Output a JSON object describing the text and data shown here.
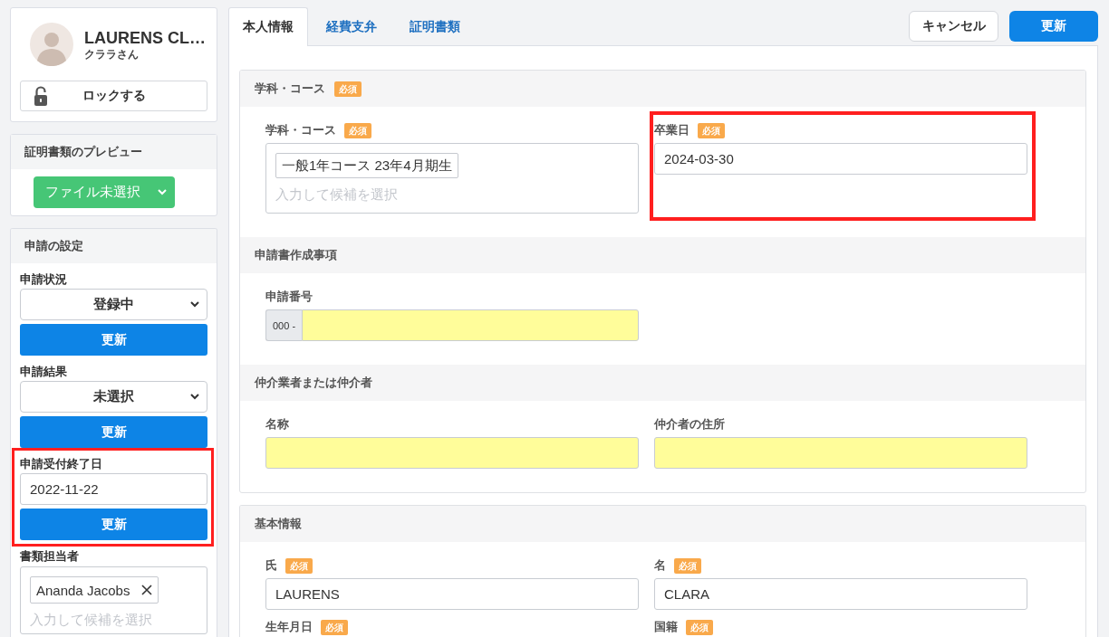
{
  "profile": {
    "name": "LAURENS CL…",
    "nickname": "クララさん",
    "lock_button": "ロックする"
  },
  "preview_panel": {
    "title": "証明書類のプレビュー",
    "file_select": "ファイル未選択"
  },
  "settings_panel": {
    "title": "申請の設定",
    "items": [
      {
        "kind": "select",
        "label": "申請状況",
        "value": "登録中",
        "button": "更新",
        "annotated": false
      },
      {
        "kind": "select",
        "label": "申請結果",
        "value": "未選択",
        "button": "更新",
        "annotated": false
      },
      {
        "kind": "date",
        "label": "申請受付終了日",
        "value": "2022-11-22",
        "button": "更新",
        "annotated": true
      },
      {
        "kind": "tags",
        "label": "書類担当者",
        "tags": [
          {
            "label": "Ananda Jacobs",
            "removable": true
          }
        ],
        "placeholder": "入力して候補を選択",
        "annotated": false
      }
    ]
  },
  "tabs": [
    {
      "label": "本人情報",
      "selected": true
    },
    {
      "label": "経費支弁",
      "selected": false
    },
    {
      "label": "証明書類",
      "selected": false
    }
  ],
  "actions": [
    {
      "kind": "cancel",
      "label": "キャンセル"
    },
    {
      "kind": "submit",
      "label": "更新"
    }
  ],
  "sections": [
    {
      "groups": [
        {
          "title": "学科・コース",
          "badge": "必須",
          "fields": [
            {
              "kind": "tags",
              "label": "学科・コース",
              "badge": "必須",
              "tags": [
                {
                  "label": "一般1年コース 23年4月期生",
                  "removable": false
                }
              ],
              "placeholder": "入力して候補を選択",
              "highlighted": false,
              "annotated": false
            },
            {
              "kind": "text",
              "label": "卒業日",
              "badge": "必須",
              "value": "2024-03-30",
              "highlighted": false,
              "annotated": true
            }
          ]
        },
        {
          "title": "申請書作成事項",
          "fields": [
            {
              "kind": "prefixed",
              "label": "申請番号",
              "prefix": "000 -",
              "highlighted": true,
              "annotated": false
            }
          ]
        },
        {
          "title": "仲介業者または仲介者",
          "fields": [
            {
              "kind": "text",
              "label": "名称",
              "highlighted": true,
              "annotated": false
            },
            {
              "kind": "text",
              "label": "仲介者の住所",
              "highlighted": true,
              "annotated": false
            }
          ]
        }
      ]
    },
    {
      "groups": [
        {
          "title": "基本情報",
          "fields": [
            {
              "kind": "text",
              "label": "氏",
              "badge": "必須",
              "value": "LAURENS",
              "highlighted": false,
              "annotated": false
            },
            {
              "kind": "text",
              "label": "名",
              "badge": "必須",
              "value": "CLARA",
              "highlighted": false,
              "annotated": false
            },
            {
              "kind": "label",
              "label": "生年月日",
              "badge": "必須",
              "annotated": false
            },
            {
              "kind": "label",
              "label": "国籍",
              "badge": "必須",
              "annotated": false
            }
          ]
        }
      ]
    }
  ]
}
